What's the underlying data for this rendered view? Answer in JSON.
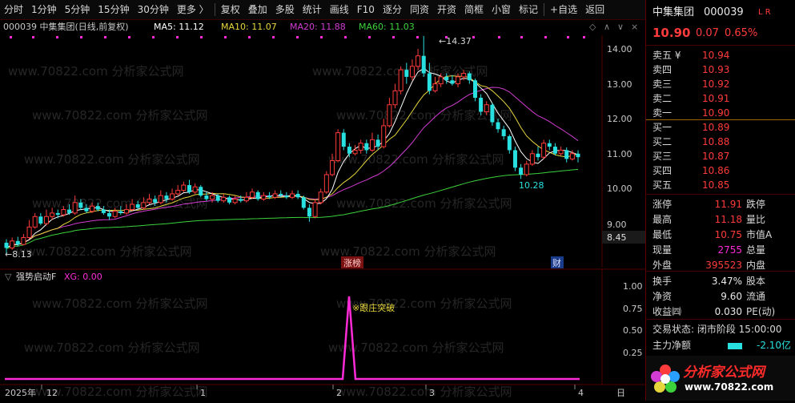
{
  "toolbar": {
    "items": [
      "分时",
      "1分钟",
      "5分钟",
      "15分钟",
      "30分钟",
      "更多 〉",
      "复权",
      "叠加",
      "多股",
      "统计",
      "画线",
      "F10",
      "逐分",
      "同资",
      "开资",
      "简框",
      "小窗",
      "标记",
      "+自选",
      "返回"
    ]
  },
  "main_legend": {
    "stock": "000039 中集集团(日线,前复权)",
    "ma5": "MA5: 11.12",
    "ma10": "MA10: 11.07",
    "ma20": "MA20: 11.88",
    "ma60": "MA60: 11.03"
  },
  "price_axis": {
    "labels": [
      "14.00",
      "13.00",
      "12.00",
      "11.00",
      "10.00",
      "9.00"
    ],
    "current_price_tag": "8.45"
  },
  "annotations": {
    "high": "14.37",
    "low": "10.28",
    "start": "8.13",
    "tag_zhangbang": "涨榜",
    "tag_cai": "财"
  },
  "indicator": {
    "title": "强势启动F",
    "xg_label": "XG: 0.00",
    "signal_text": "※跟庄突破",
    "axis": [
      "1.00",
      "0.75",
      "0.50",
      "0.25"
    ]
  },
  "time_axis": {
    "labels": [
      "2025年",
      "12",
      "1",
      "2",
      "3",
      "4"
    ],
    "right_label": "日"
  },
  "watermark": "www.70822.com 分析家公式网",
  "quote": {
    "name": "中集集团",
    "code": "000039",
    "tags": "L R",
    "last": "10.90",
    "change": "0.07",
    "change_pct": "0.65%",
    "order_book": [
      {
        "label": "卖五 ¥",
        "price": "10.94"
      },
      {
        "label": "卖四",
        "price": "10.93"
      },
      {
        "label": "卖三",
        "price": "10.92"
      },
      {
        "label": "卖二",
        "price": "10.91"
      },
      {
        "label": "卖一",
        "price": "10.90"
      },
      {
        "label": "买一",
        "price": "10.89"
      },
      {
        "label": "买二",
        "price": "10.88"
      },
      {
        "label": "买三",
        "price": "10.87"
      },
      {
        "label": "买四",
        "price": "10.86"
      },
      {
        "label": "买五",
        "price": "10.85"
      }
    ],
    "stats": [
      {
        "label": "涨停",
        "value": "11.91",
        "label2": "跌停"
      },
      {
        "label": "最高",
        "value": "11.18",
        "label2": "量比"
      },
      {
        "label": "最低",
        "value": "10.75",
        "label2": "市值A"
      },
      {
        "label": "现量",
        "value": "2755",
        "label2": "总量"
      },
      {
        "label": "外盘",
        "value": "395523",
        "label2": "内盘"
      }
    ],
    "stats2": [
      {
        "label": "换手",
        "value": "3.47%",
        "label2": "股本"
      },
      {
        "label": "净资",
        "value": "9.60",
        "label2": "流通"
      },
      {
        "label": "收益㈣",
        "value": "0.030",
        "label2": "PE(动)"
      }
    ],
    "trade_state": "交易状态: 闭市阶段 15:00:00",
    "net_flow_label": "主力净额",
    "net_flow_value": "-2.10亿",
    "logo_text": "分析家公式网",
    "logo_url": "www.70822.com"
  },
  "colors": {
    "up": "#ff3b3b",
    "down": "#29e0e0",
    "ma5": "#ffffff",
    "ma10": "#e6d63c",
    "ma20": "#d23cd2",
    "ma60": "#3cd23c",
    "indicator": "#ff2bd6"
  }
}
